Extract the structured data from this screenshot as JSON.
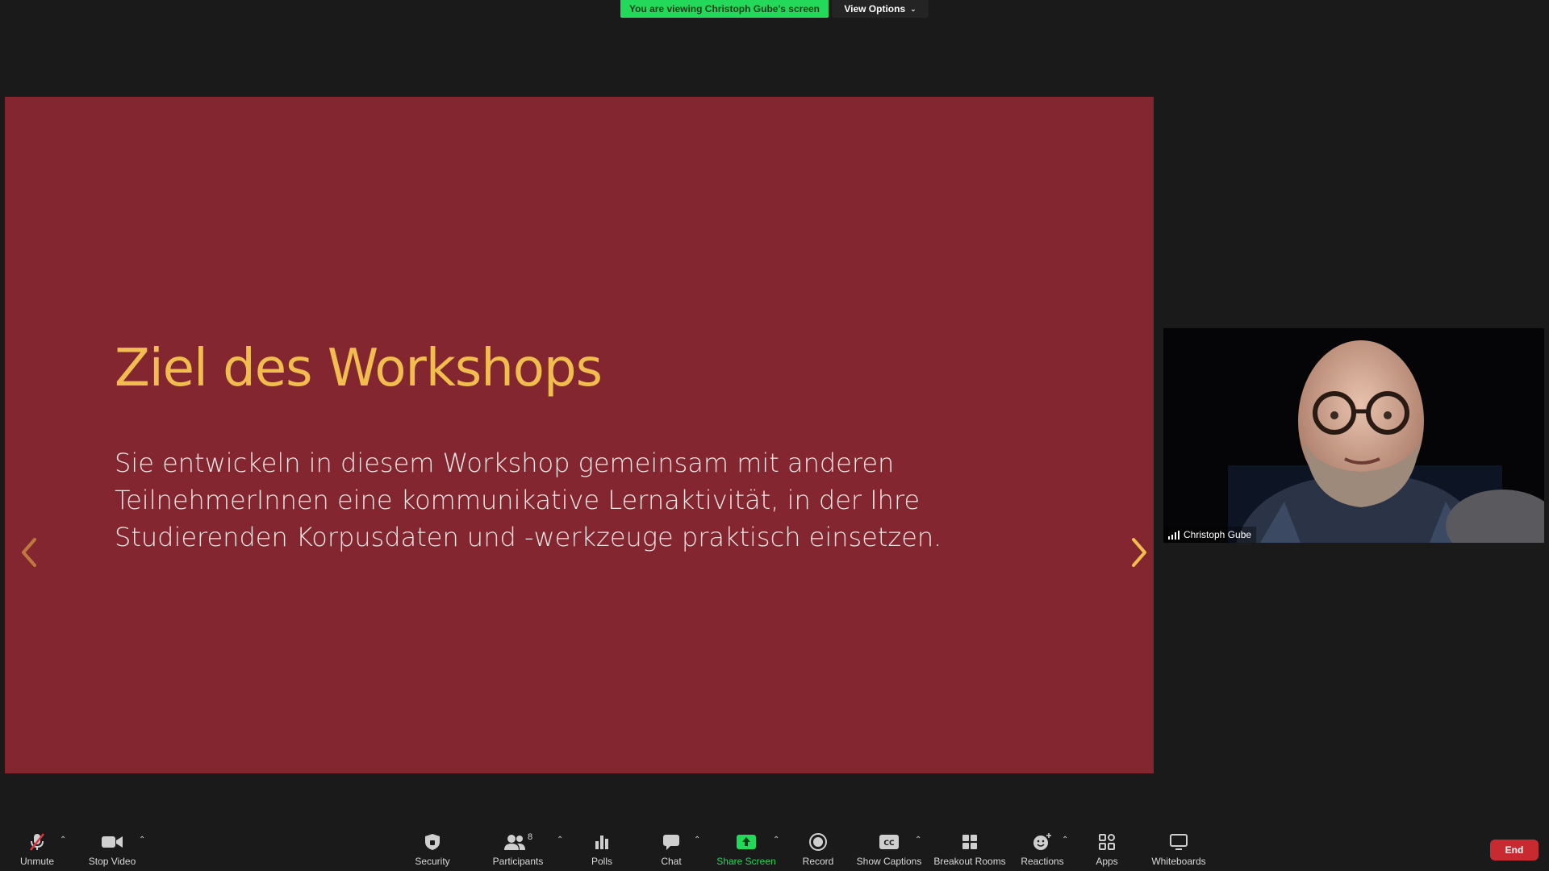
{
  "banner": {
    "viewing_text": "You are viewing Christoph Gube's screen",
    "view_options_label": "View Options"
  },
  "slide": {
    "title": "Ziel des Workshops",
    "body": "Sie entwickeln in diesem Workshop gemeinsam mit anderen TeilnehmerInnen eine kommunikative Lernaktivität, in der Ihre Studierenden Korpusdaten und -werkzeuge praktisch einsetzen.",
    "background_color": "#83262f",
    "title_color": "#f0bd4e",
    "prev_icon": "chevron-left-icon",
    "next_icon": "chevron-right-icon"
  },
  "participant_video": {
    "name": "Christoph Gube"
  },
  "toolbar": {
    "unmute": "Unmute",
    "stop_video": "Stop Video",
    "security": "Security",
    "participants": "Participants",
    "participants_count": "8",
    "polls": "Polls",
    "chat": "Chat",
    "share_screen": "Share Screen",
    "record": "Record",
    "show_captions": "Show Captions",
    "breakout_rooms": "Breakout Rooms",
    "reactions": "Reactions",
    "apps": "Apps",
    "whiteboards": "Whiteboards",
    "end": "End"
  },
  "colors": {
    "accent_green": "#23d959",
    "end_red": "#c72a31",
    "background": "#1a1a1a"
  }
}
